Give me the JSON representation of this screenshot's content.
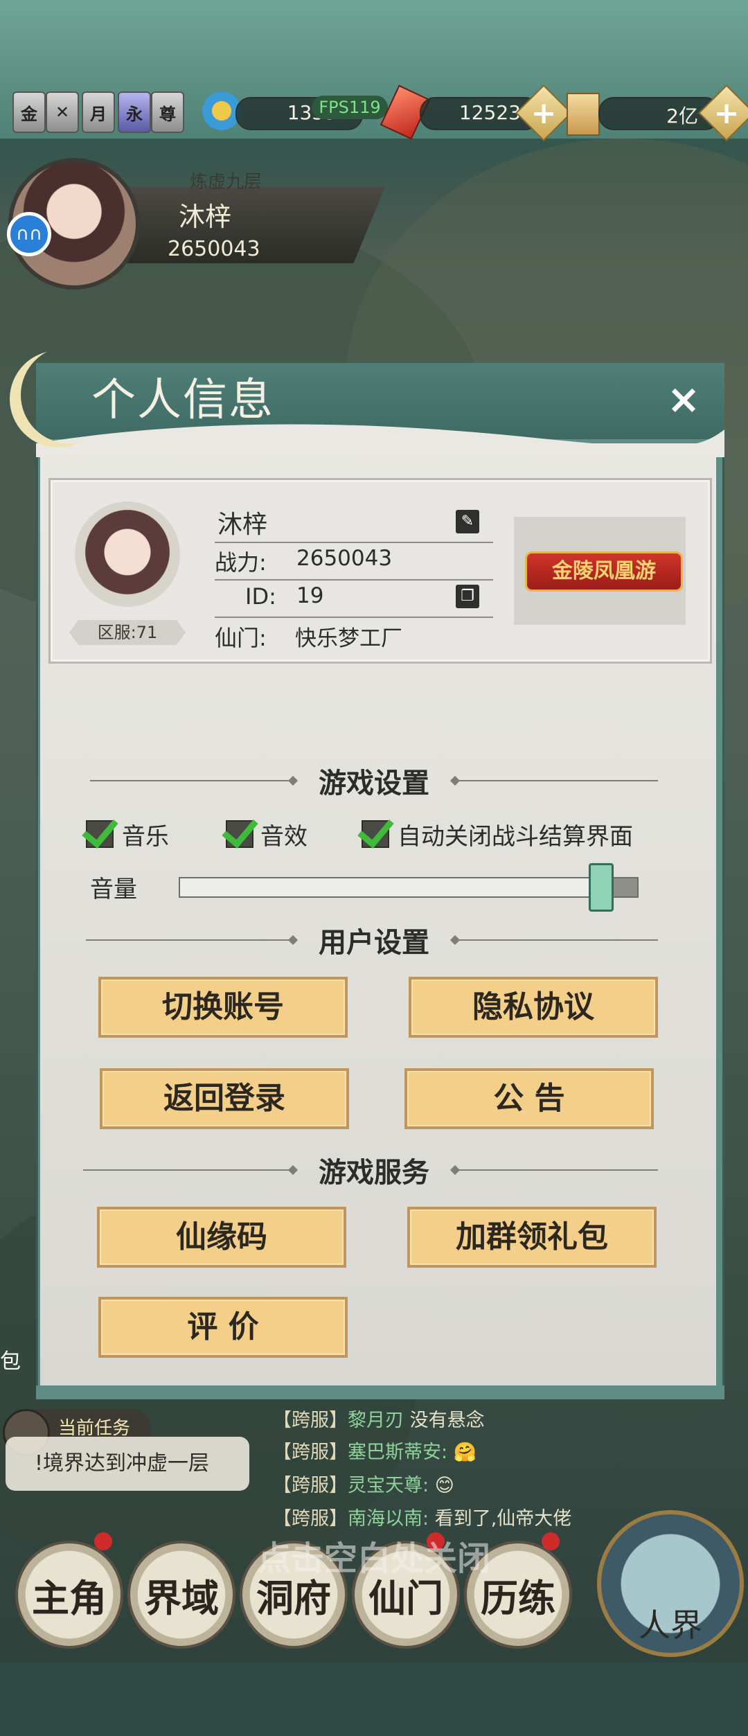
{
  "topbar": {
    "side_icons": [
      "金",
      "✕",
      "月",
      "永",
      "尊"
    ],
    "fps": "FPS119",
    "resource1_value": "1335",
    "resource2_value": "12523",
    "resource3_value": "2亿"
  },
  "player_header": {
    "realm": "炼虚九层",
    "name": "沐梓",
    "power": "2650043"
  },
  "dialog": {
    "title": "个人信息",
    "close": "×",
    "profile": {
      "name": "沐梓",
      "power_label": "战力:",
      "power_value": "2650043",
      "id_label": "ID:",
      "id_value": "19",
      "sect_label": "仙门:",
      "sect_value": "快乐梦工厂",
      "server": "区服:71",
      "banner": "金陵凤凰游"
    },
    "game_settings": {
      "title": "游戏设置",
      "music": "音乐",
      "sound_effects": "音效",
      "auto_close": "自动关闭战斗结算界面",
      "volume_label": "音量",
      "volume_level": 0.92
    },
    "user_settings": {
      "title": "用户设置",
      "switch_account": "切换账号",
      "privacy": "隐私协议",
      "back_login": "返回登录",
      "notice": "公 告"
    },
    "game_services": {
      "title": "游戏服务",
      "fate_code": "仙缘码",
      "join_group": "加群领礼包",
      "rate": "评 价"
    }
  },
  "task": {
    "label": "当前任务",
    "text": "!境界达到冲虚一层"
  },
  "chat": [
    {
      "tag": "【跨服】",
      "who": "黎月刃",
      "msg": "没有悬念"
    },
    {
      "tag": "【跨服】",
      "who": "塞巴斯蒂安:",
      "msg": "🤗"
    },
    {
      "tag": "【跨服】",
      "who": "灵宝天尊:",
      "msg": "😊"
    },
    {
      "tag": "【跨服】",
      "who": "南海以南:",
      "msg": "看到了,仙帝大佬"
    }
  ],
  "hint": "点击空白处关闭",
  "nav": [
    "主角",
    "界域",
    "洞府",
    "仙门",
    "历练"
  ],
  "realm_button": "人界",
  "left_side_label": "包"
}
